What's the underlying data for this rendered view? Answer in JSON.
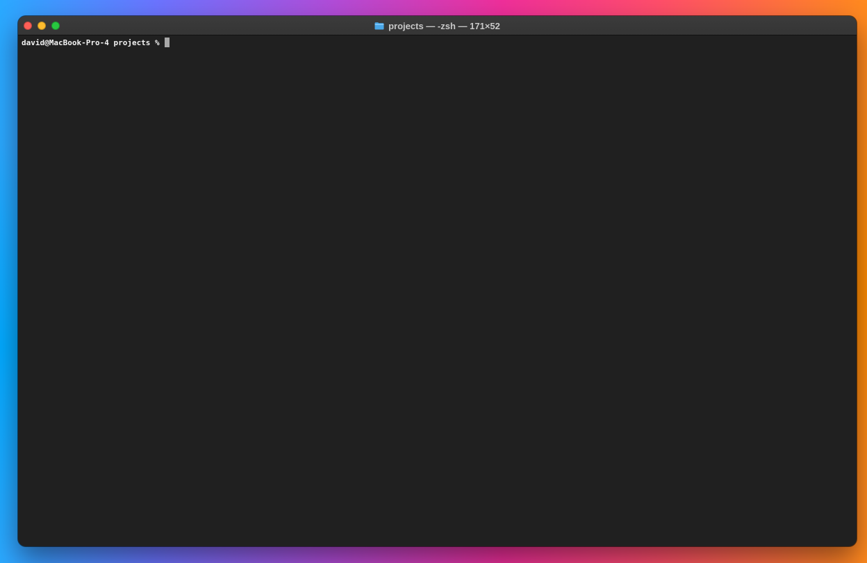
{
  "window": {
    "title": "projects — -zsh — 171×52",
    "title_icon": "folder-icon"
  },
  "terminal": {
    "prompt": "david@MacBook-Pro-4 projects % "
  },
  "colors": {
    "terminal_background": "#202020",
    "titlebar": "#383838",
    "text": "#f2f2f2",
    "close": "#ff5f57",
    "minimize": "#febc2e",
    "zoom": "#28c840"
  }
}
